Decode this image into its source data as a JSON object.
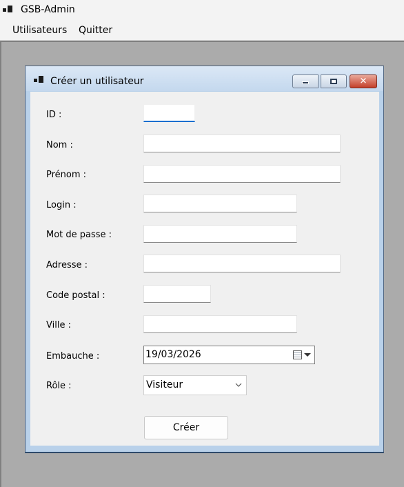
{
  "window": {
    "title": "GSB-Admin"
  },
  "menu": {
    "items": [
      {
        "label": "Utilisateurs"
      },
      {
        "label": "Quitter"
      }
    ]
  },
  "child": {
    "title": "Créer un utilisateur",
    "caption_buttons": {
      "minimize": "minimize-icon",
      "maximize": "maximize-icon",
      "close": "close-icon",
      "close_glyph": "✕"
    }
  },
  "form": {
    "id_label": "ID :",
    "id_value": "",
    "nom_label": "Nom :",
    "nom_value": "",
    "prenom_label": "Prénom :",
    "prenom_value": "",
    "login_label": "Login :",
    "login_value": "",
    "mdp_label": "Mot de passe :",
    "mdp_value": "",
    "adresse_label": "Adresse :",
    "adresse_value": "",
    "cp_label": "Code postal :",
    "cp_value": "",
    "ville_label": "Ville :",
    "ville_value": "",
    "embauche_label": "Embauche :",
    "embauche_value": "19/03/2026",
    "role_label": "Rôle :",
    "role_value": "Visiteur",
    "submit_label": "Créer"
  },
  "colors": {
    "focus_accent": "#1a6fcf",
    "close_button": "#c4402a",
    "mdi_background": "#ababab"
  }
}
